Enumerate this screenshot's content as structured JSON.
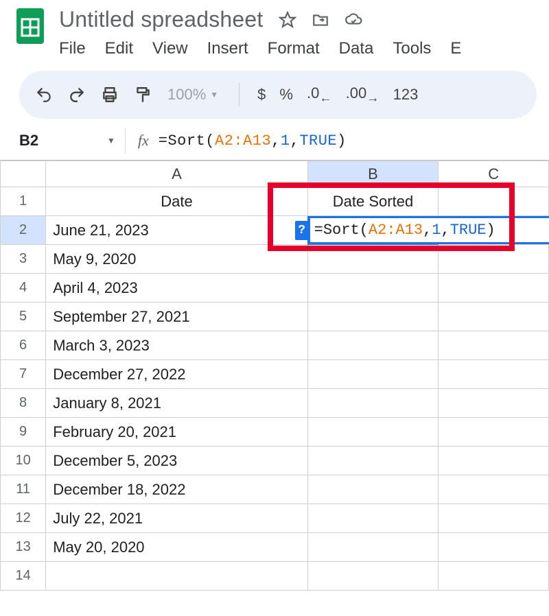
{
  "doc": {
    "title": "Untitled spreadsheet"
  },
  "menubar": [
    "File",
    "Edit",
    "View",
    "Insert",
    "Format",
    "Data",
    "Tools",
    "E"
  ],
  "toolbar": {
    "zoom": "100%",
    "currency": "$",
    "percent": "%",
    "dec_less": ".0",
    "dec_more": ".00",
    "num123": "123"
  },
  "namebox": "B2",
  "formula": {
    "fn": "=Sort",
    "open": "(",
    "range": "A2:A13",
    "c1": ",",
    "arg2": "1",
    "c2": ",",
    "arg3": "TRUE",
    "close": ")"
  },
  "columns": [
    "A",
    "B",
    "C"
  ],
  "headers": {
    "A": "Date",
    "B": "Date Sorted"
  },
  "rows": [
    {
      "n": 1
    },
    {
      "n": 2,
      "A": "June 21, 2023"
    },
    {
      "n": 3,
      "A": "May 9, 2020"
    },
    {
      "n": 4,
      "A": "April 4, 2023"
    },
    {
      "n": 5,
      "A": "September 27, 2021"
    },
    {
      "n": 6,
      "A": "March 3, 2023"
    },
    {
      "n": 7,
      "A": "December 27, 2022"
    },
    {
      "n": 8,
      "A": "January 8, 2021"
    },
    {
      "n": 9,
      "A": "February 20, 2021"
    },
    {
      "n": 10,
      "A": "December 5, 2023"
    },
    {
      "n": 11,
      "A": "December 18, 2022"
    },
    {
      "n": 12,
      "A": "July 22, 2021"
    },
    {
      "n": 13,
      "A": "May 20, 2020"
    },
    {
      "n": 14
    }
  ],
  "hint": "?"
}
